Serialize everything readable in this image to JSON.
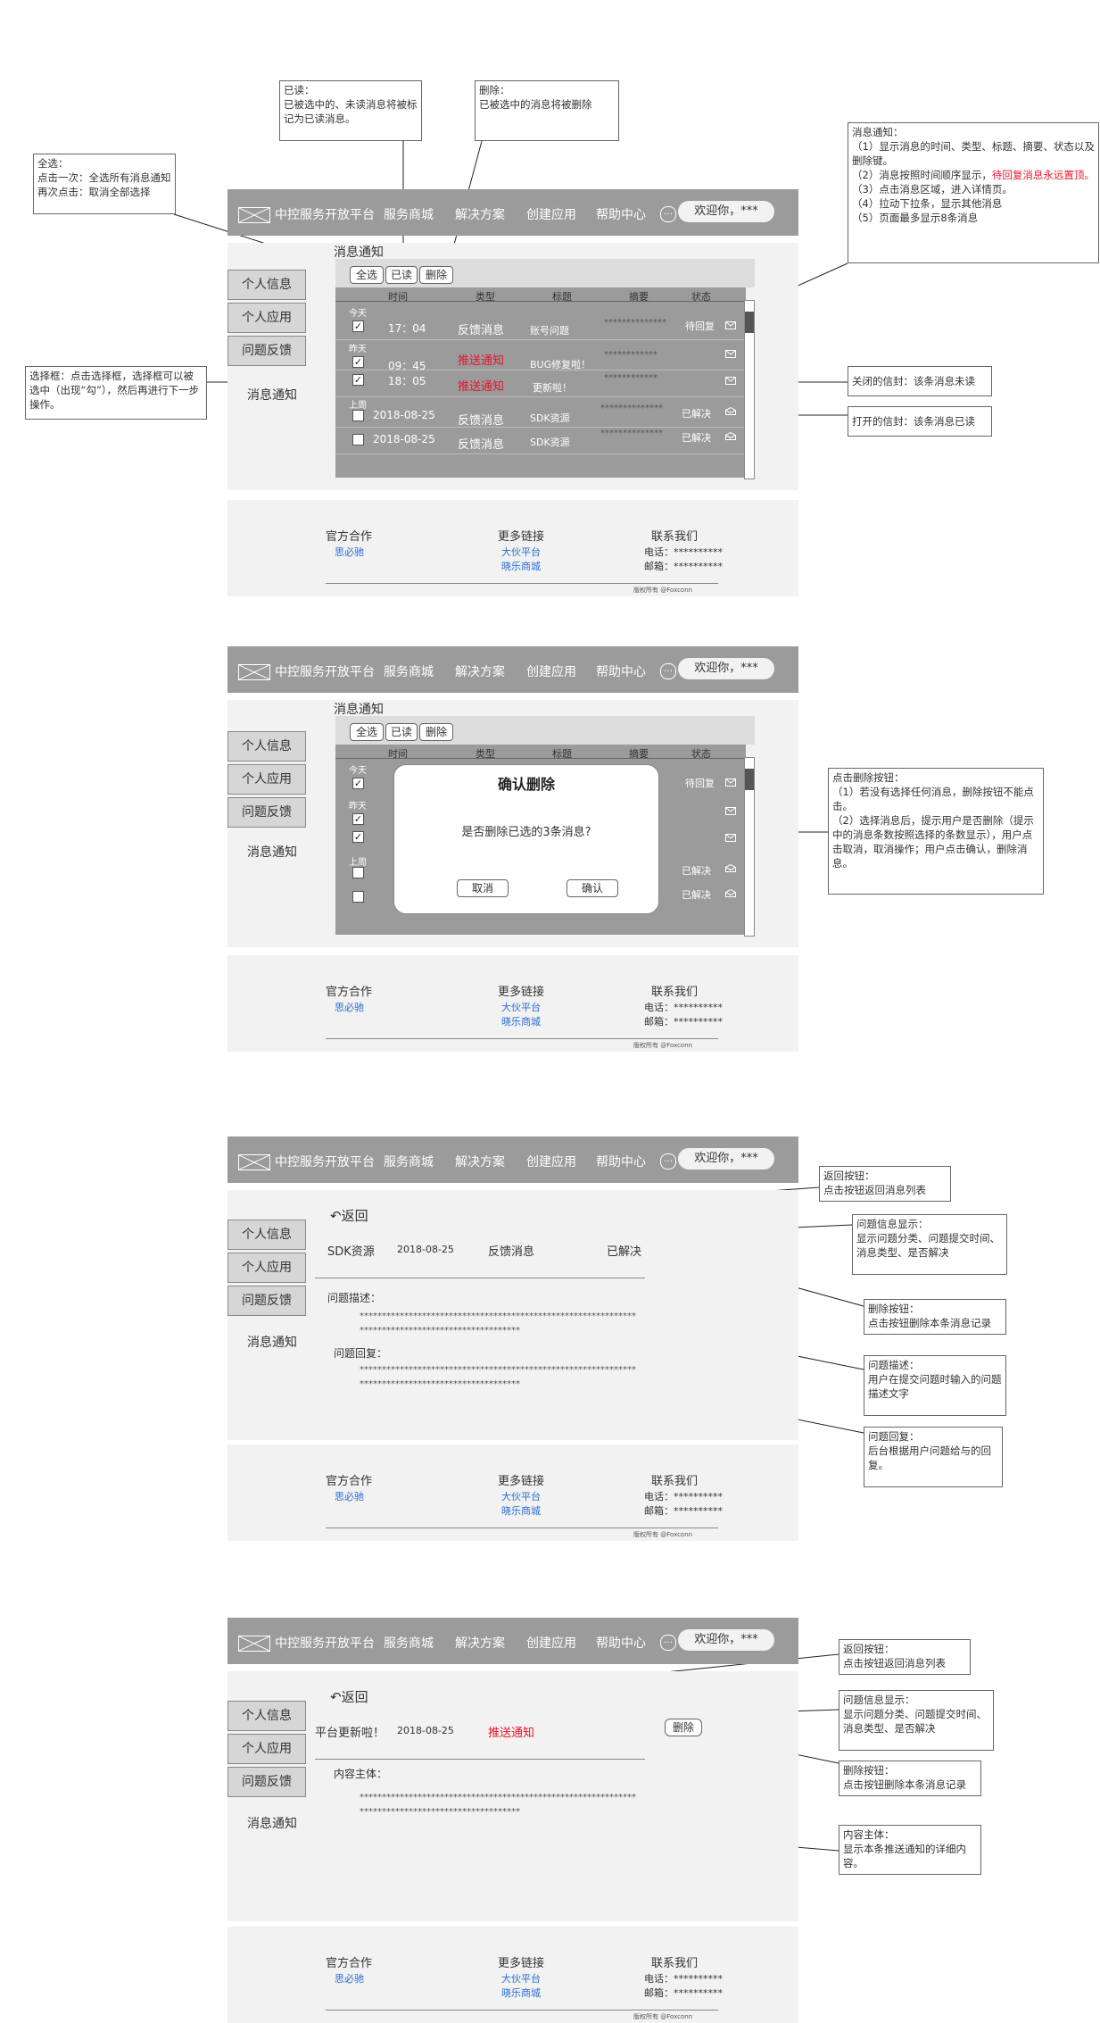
{
  "header": {
    "brand": "中控服务开放平台",
    "nav": [
      "服务商城",
      "解决方案",
      "创建应用",
      "帮助中心"
    ],
    "chat_icon": "…",
    "welcome": "欢迎你，***"
  },
  "sidebar": {
    "items": [
      "个人信息",
      "个人应用",
      "问题反馈"
    ],
    "current": "消息通知"
  },
  "footer": {
    "col1_title": "官方合作",
    "col1_links": [
      "思必驰"
    ],
    "col2_title": "更多链接",
    "col2_links": [
      "大伙平台",
      "晓乐商城"
    ],
    "col3_title": "联系我们",
    "phone": "电话：**********",
    "email": "邮箱：**********",
    "copyright": "版权所有 @Foxconn"
  },
  "messages": {
    "title": "消息通知",
    "buttons": {
      "select_all": "全选",
      "read": "已读",
      "delete": "删除"
    },
    "columns": [
      "时间",
      "类型",
      "标题",
      "摘要",
      "状态"
    ],
    "groups": {
      "today": "今天",
      "yesterday": "昨天",
      "last_week": "上周"
    },
    "rows": [
      {
        "time": "17：04",
        "type": "反馈消息",
        "title": "账号问题",
        "summary": "**************",
        "status": "待回复",
        "checked": true
      },
      {
        "time": "09：45",
        "type": "推送通知",
        "title": "BUG修复啦！",
        "summary": "************",
        "status": "",
        "checked": true
      },
      {
        "time": "18：05",
        "type": "推送通知",
        "title": "更新啦！",
        "summary": "************",
        "status": "",
        "checked": true
      },
      {
        "time": "2018-08-25",
        "type": "反馈消息",
        "title": "SDK资源",
        "summary": "**************",
        "status": "已解决",
        "checked": false
      },
      {
        "time": "2018-08-25",
        "type": "反馈消息",
        "title": "SDK资源",
        "summary": "**************",
        "status": "已解决",
        "checked": false
      }
    ]
  },
  "modal": {
    "title": "确认删除",
    "message": "是否删除已选的3条消息?",
    "cancel": "取消",
    "confirm": "确认"
  },
  "detail_feedback": {
    "back": "返回",
    "title": "SDK资源",
    "date": "2018-08-25",
    "type": "反馈消息",
    "status": "已解决",
    "desc_label": "问题描述：",
    "desc_line1": "**************************************************************",
    "desc_line2": "************************************",
    "reply_label": "问题回复：",
    "reply_line1": "**************************************************************",
    "reply_line2": "************************************"
  },
  "detail_push": {
    "back": "返回",
    "title": "平台更新啦！",
    "date": "2018-08-25",
    "type": "推送通知",
    "delete": "删除",
    "body_label": "内容主体：",
    "body_line1": "**************************************************************",
    "body_line2": "************************************"
  },
  "notes": {
    "select_all": "全选：\n点击一次：全选所有消息通知\n再次点击：取消全部选择",
    "read": "已读：\n已被选中的、未读消息将被标记为已读消息。",
    "delete": "删除：\n已被选中的消息将被删除",
    "checkbox": "选择框：点击选择框，选择框可以被选中（出现“勾”），然后再进行下一步操作。",
    "msg_intro": "消息通知：",
    "msg_1": "（1）显示消息的时间、类型、标题、摘要、状态以及删除键。",
    "msg_2a": "（2）消息按照时间顺序显示，",
    "msg_2b": "待回复消息永远置顶。",
    "msg_3": "（3）点击消息区域，进入详情页。",
    "msg_4": "（4）拉动下拉条，显示其他消息",
    "msg_5": "（5）页面最多显示8条消息",
    "closed_env": "关闭的信封：该条消息未读",
    "open_env": "打开的信封：该条消息已读",
    "delete_btn": "点击删除按钮：\n（1）若没有选择任何消息，删除按钮不能点击。\n（2）选择消息后，提示用户是否删除（提示中的消息条数按照选择的条数显示），用户点击取消，取消操作；用户点击确认，删除消息。",
    "back_btn": "返回按钮：\n点击按钮返回消息列表",
    "info_display": "问题信息显示：\n显示问题分类、问题提交时间、消息类型、是否解决",
    "delete_record": "删除按钮：\n点击按钮删除本条消息记录",
    "desc_note": "问题描述：\n用户在提交问题时输入的问题描述文字",
    "reply_note": "问题回复：\n后台根据用户问题给与的回复。",
    "back_btn2": "返回按钮：\n点击按钮返回消息列表",
    "info_display2": "问题信息显示：\n显示问题分类、问题提交时间、消息类型、是否解决",
    "delete_record2": "删除按钮：\n点击按钮删除本条消息记录",
    "content_note": "内容主体：\n显示本条推送通知的详细内容。"
  }
}
